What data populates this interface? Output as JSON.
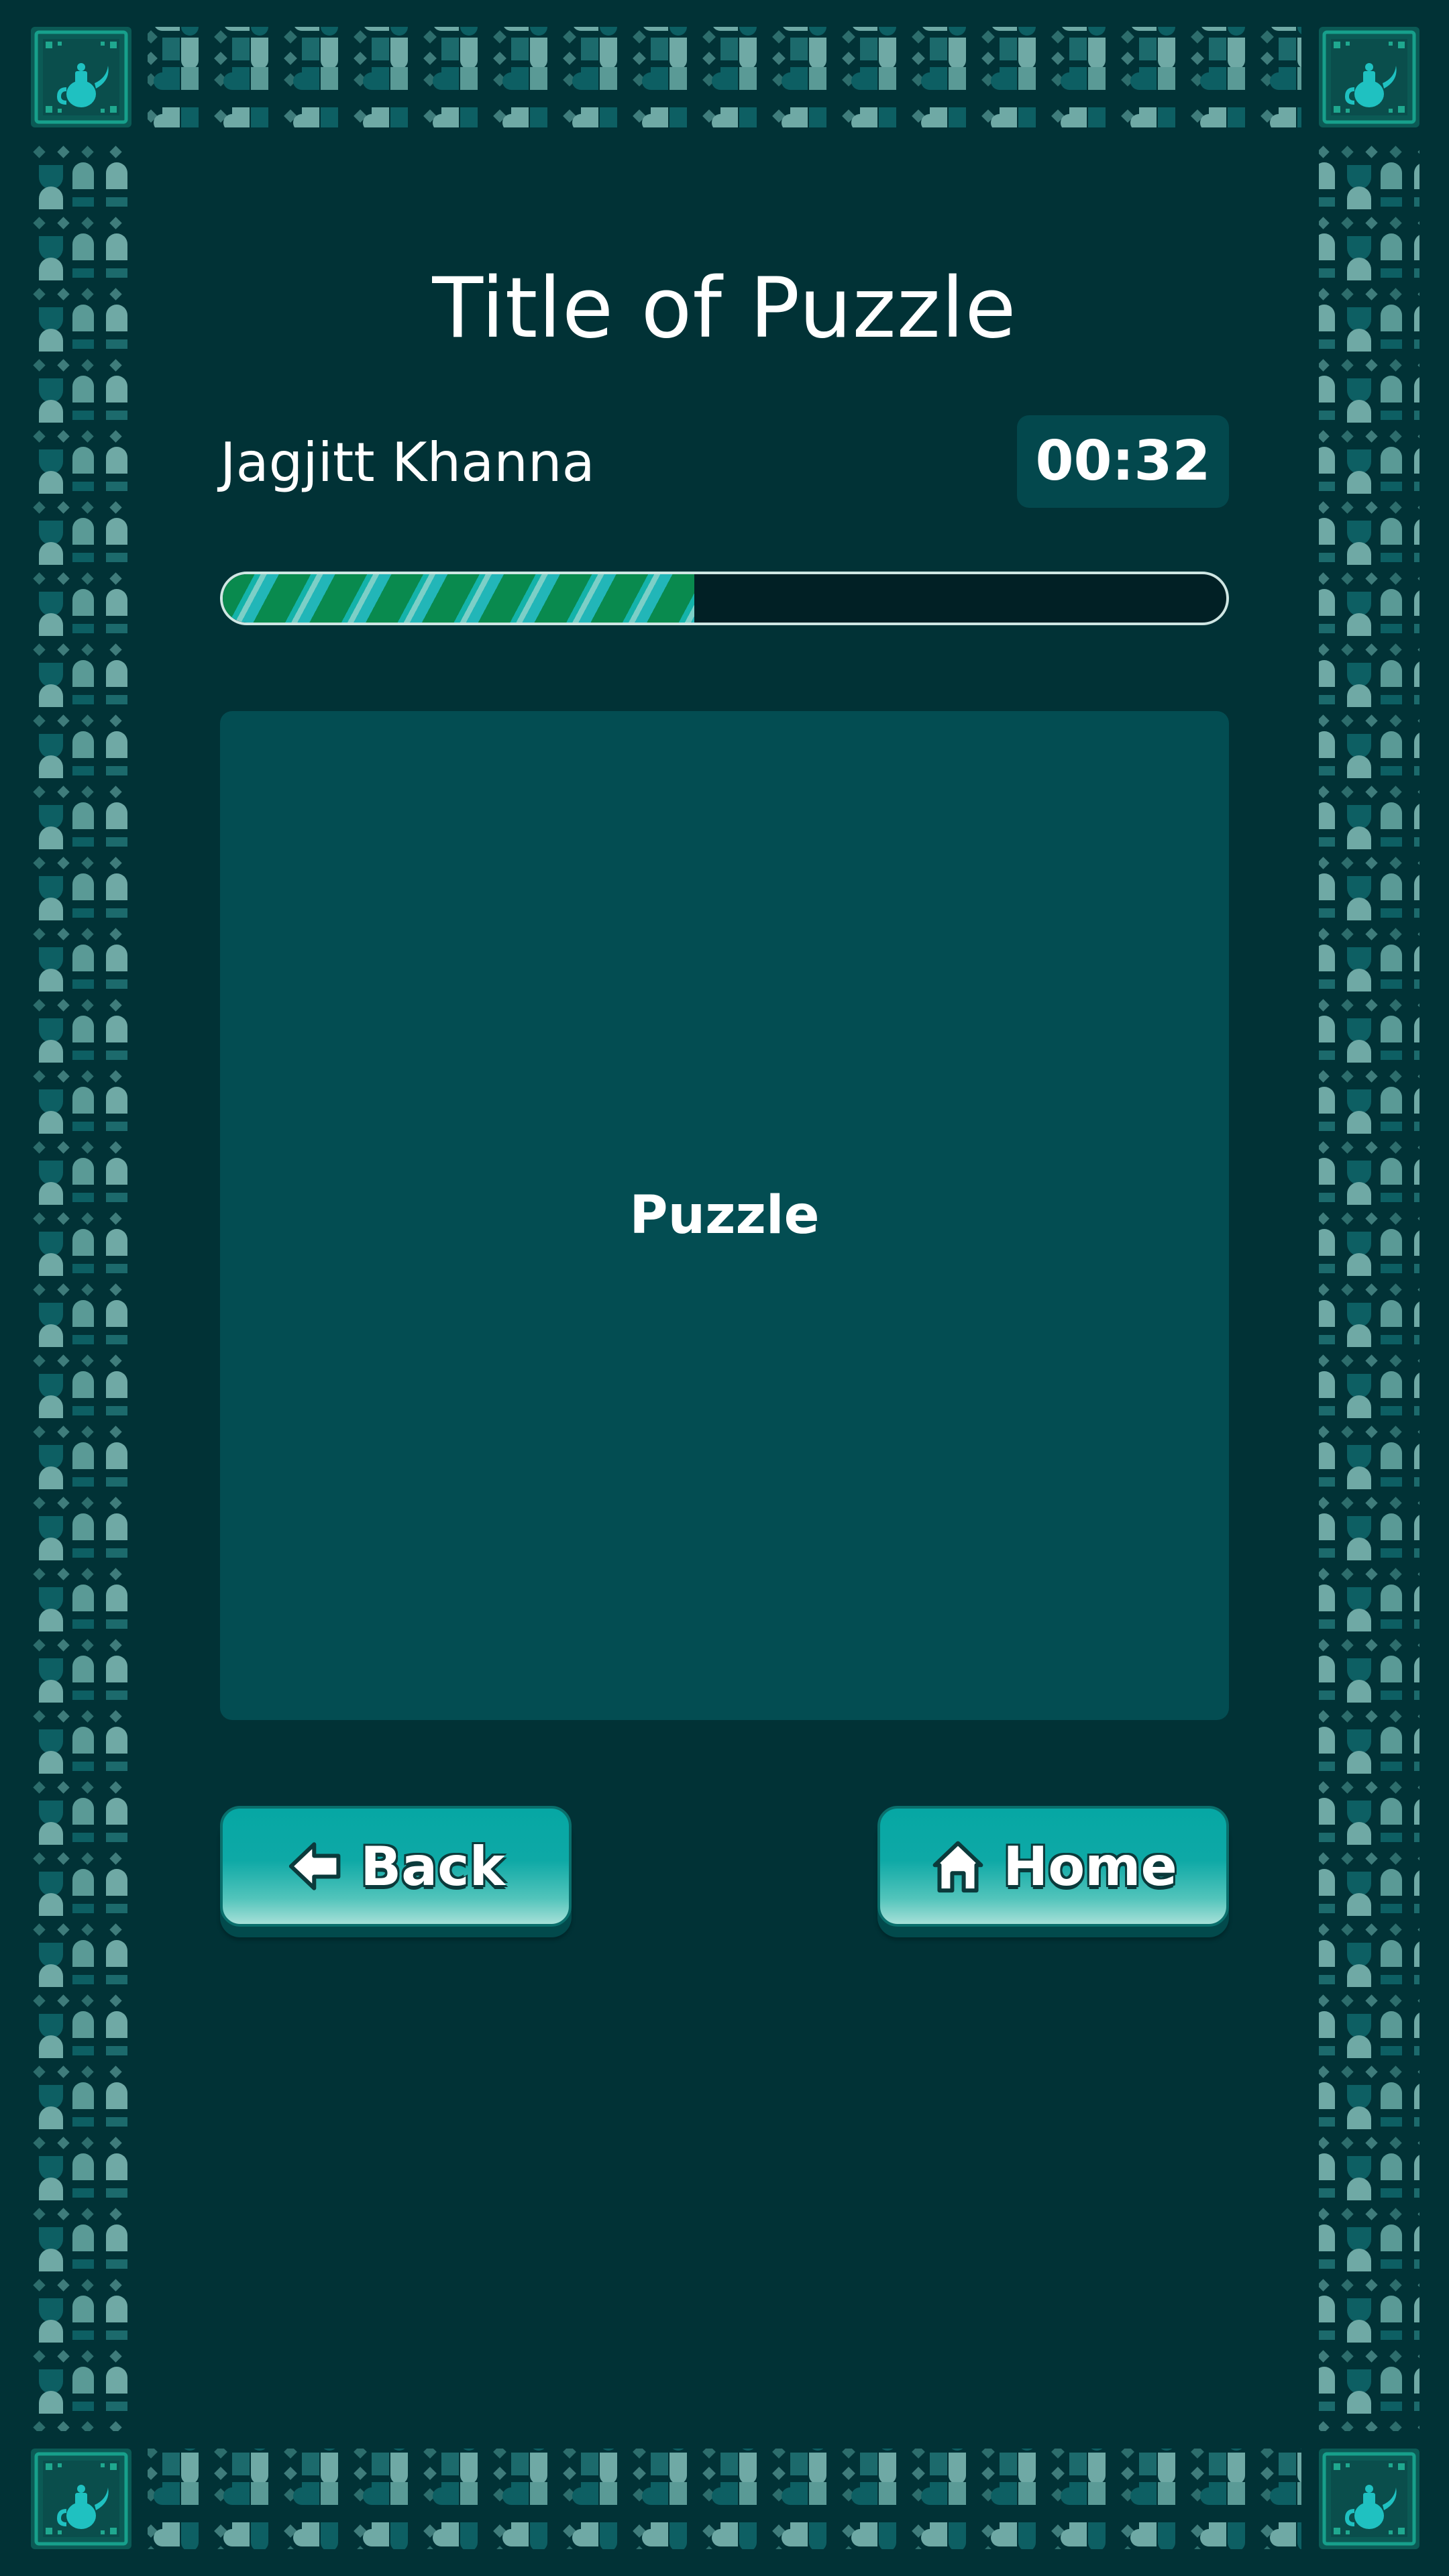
{
  "header": {
    "title": "Title of Puzzle"
  },
  "player": {
    "name": "Jagjitt Khanna",
    "timer": "00:32"
  },
  "progress": {
    "fraction": 0.47
  },
  "board": {
    "label": "Puzzle"
  },
  "buttons": {
    "back_label": "Back",
    "home_label": "Home"
  },
  "icons": {
    "back": "arrow-left-icon",
    "home": "house-icon",
    "corner": "teapot-emblem-icon"
  },
  "colors": {
    "background": "#013236",
    "board": "#034d52",
    "accent": "#0ea9a6",
    "progress_green": "#098a4e",
    "border_tile_light": "#6fa9a5",
    "border_tile_dark": "#0d5f63"
  }
}
